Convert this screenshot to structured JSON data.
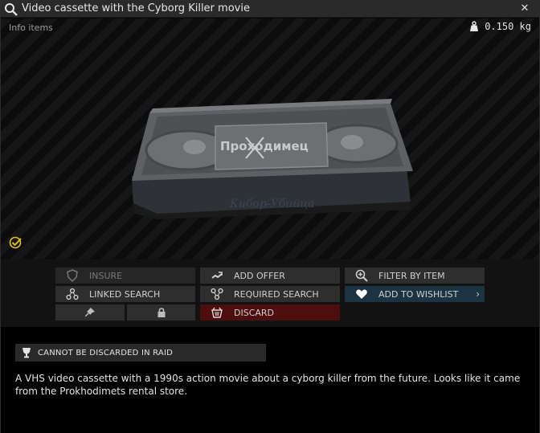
{
  "window": {
    "title": "Video cassette with the Cyborg Killer movie",
    "close_label": "✕"
  },
  "preview": {
    "category": "Info items",
    "weight": "0.150 kg",
    "cassette_label_brand": "Проходимец"
  },
  "actions": {
    "insure": "INSURE",
    "add_offer": "ADD OFFER",
    "filter_by_item": "FILTER BY ITEM",
    "linked_search": "LINKED SEARCH",
    "required_search": "REQUIRED SEARCH",
    "add_to_wishlist": "ADD TO WISHLIST",
    "discard": "DISCARD"
  },
  "restriction": {
    "text": "CANNOT BE DISCARDED IN RAID"
  },
  "description": "A VHS video cassette with a 1990s action movie about a cyborg killer from the future. Looks like it came from the Prokhodimets rental store.",
  "colors": {
    "wishlist_bg": "#1c3342",
    "discard_bg": "#4f0e0e",
    "check_yellow": "#e6c21f"
  }
}
